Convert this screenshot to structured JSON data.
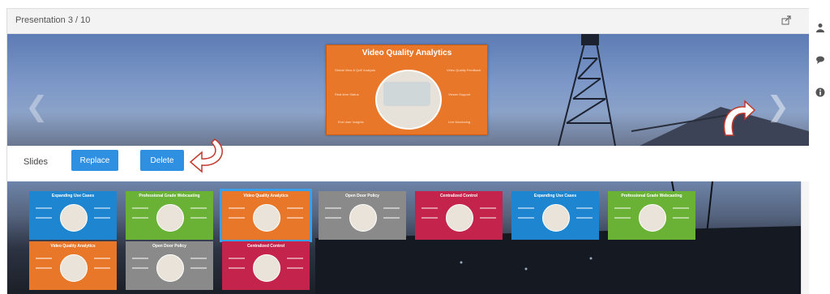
{
  "header": {
    "title": "Presentation 3 / 10"
  },
  "current_slide": {
    "title": "Video Quality Analytics",
    "labels": [
      "Global View & QoE Analysis",
      "Video Quality Feedback",
      "Real-time Status",
      "Viewer Support",
      "End User Insights",
      "Live Monitoring"
    ]
  },
  "slides_bar": {
    "label": "Slides",
    "replace_label": "Replace",
    "delete_label": "Delete"
  },
  "thumbnails": [
    {
      "title": "Expanding Use Cases",
      "color": "#1e86d0",
      "kind": "faces"
    },
    {
      "title": "Professional Grade Webcasting",
      "color": "#6ab235",
      "kind": "person"
    },
    {
      "title": "Video Quality Analytics",
      "color": "#e8772a",
      "kind": "map"
    },
    {
      "title": "Open Door Policy",
      "color": "#8a8a8a",
      "kind": "group"
    },
    {
      "title": "Centralized Control",
      "color": "#c4234b",
      "kind": "chart"
    },
    {
      "title": "Expanding Use Cases",
      "color": "#1e86d0",
      "kind": "faces"
    },
    {
      "title": "Professional Grade Webcasting",
      "color": "#6ab235",
      "kind": "person"
    },
    {
      "title": "Video Quality Analytics",
      "color": "#e8772a",
      "kind": "map"
    },
    {
      "title": "Open Door Policy",
      "color": "#8a8a8a",
      "kind": "group"
    },
    {
      "title": "Centralized Control",
      "color": "#c4234b",
      "kind": "chart"
    }
  ],
  "selected_thumbnail": 3,
  "colors": {
    "button": "#2f8fe0",
    "selected_outline": "#3aa0ea"
  },
  "rail": {
    "icons": [
      "user-icon",
      "chat-icon",
      "info-icon"
    ]
  },
  "icons": {
    "share": "share-icon",
    "prev": "chevron-left-icon",
    "next": "chevron-right-icon",
    "annotation": "curved-arrow-icon"
  }
}
